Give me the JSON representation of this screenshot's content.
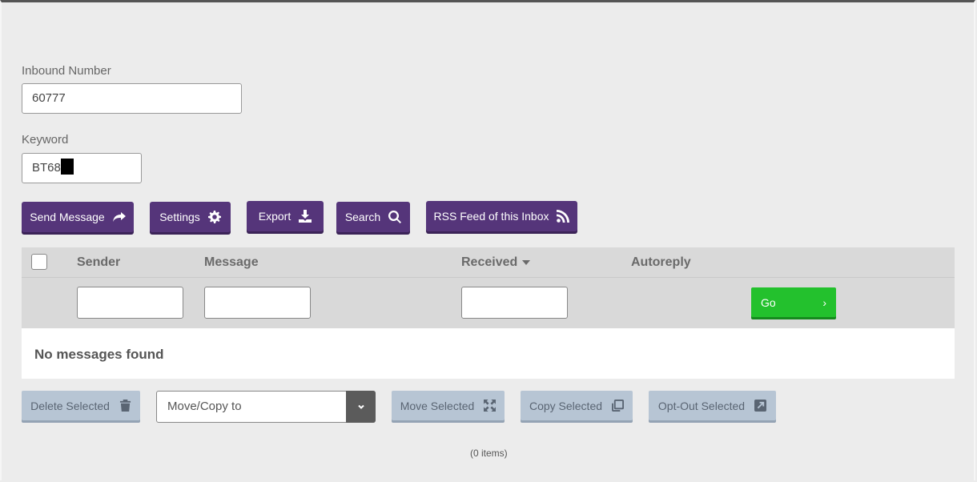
{
  "form": {
    "inbound_label": "Inbound Number",
    "inbound_value": "60777",
    "keyword_label": "Keyword",
    "keyword_value": "BT68"
  },
  "toolbar": {
    "send_message": "Send Message",
    "settings": "Settings",
    "export": "Export",
    "search": "Search",
    "rss": "RSS Feed of this Inbox"
  },
  "table": {
    "columns": [
      "Sender",
      "Message",
      "Received",
      "Autoreply"
    ],
    "sort_column": "Received",
    "go_label": "Go",
    "go_chevron": "›",
    "empty_message": "No messages found"
  },
  "actions": {
    "delete_selected": "Delete Selected",
    "move_copy_placeholder": "Move/Copy to",
    "move_selected": "Move Selected",
    "copy_selected": "Copy Selected",
    "opt_out_selected": "Opt-Out Selected"
  },
  "footer": {
    "count": "(0 items)"
  },
  "colors": {
    "primary": "#55357a",
    "go": "#23c12d",
    "disabled": "#b7c5d4",
    "background": "#ececec"
  }
}
